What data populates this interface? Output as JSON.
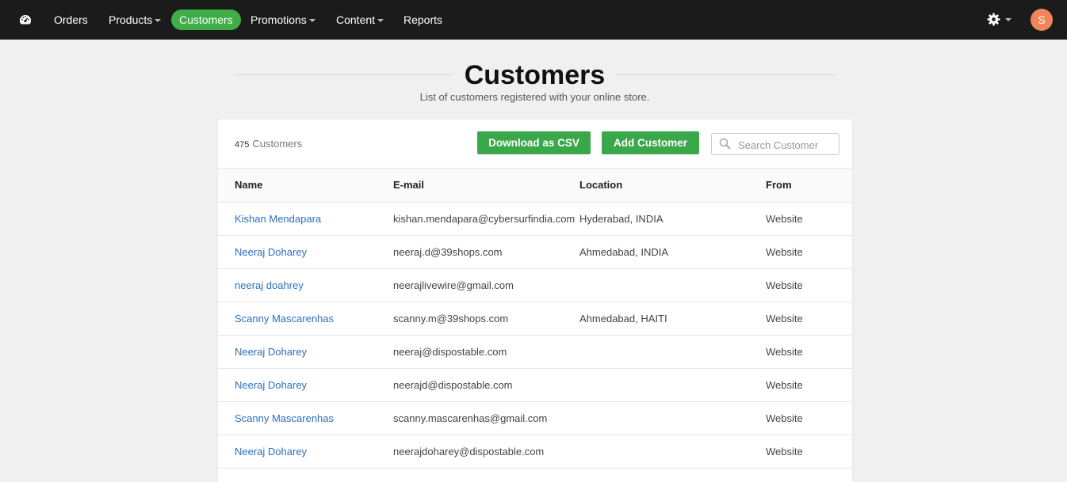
{
  "nav": {
    "dashboard_icon": "dashboard-icon",
    "items": [
      {
        "label": "Orders"
      },
      {
        "label": "Products"
      },
      {
        "label": "Customers"
      },
      {
        "label": "Promotions"
      },
      {
        "label": "Content"
      },
      {
        "label": "Reports"
      }
    ],
    "settings_icon": "gear-icon",
    "avatar_initial": "S",
    "accent_color": "#3fae49",
    "avatar_color": "#f0845a"
  },
  "page": {
    "title": "Customers",
    "subtitle": "List of customers registered with your online store."
  },
  "toolbar": {
    "count": "475",
    "count_label": "Customers",
    "download_label": "Download as CSV",
    "add_label": "Add Customer",
    "search_placeholder": "Search Customer"
  },
  "table": {
    "headers": [
      "Name",
      "E-mail",
      "Location",
      "From"
    ],
    "rows": [
      {
        "name": "Kishan Mendapara",
        "email": "kishan.mendapara@cybersurfindia.com",
        "location": "Hyderabad, INDIA",
        "from": "Website"
      },
      {
        "name": "Neeraj Doharey",
        "email": "neeraj.d@39shops.com",
        "location": "Ahmedabad, INDIA",
        "from": "Website"
      },
      {
        "name": "neeraj doahrey",
        "email": "neerajlivewire@gmail.com",
        "location": "",
        "from": "Website"
      },
      {
        "name": "Scanny Mascarenhas",
        "email": "scanny.m@39shops.com",
        "location": "Ahmedabad, HAITI",
        "from": "Website"
      },
      {
        "name": "Neeraj Doharey",
        "email": "neeraj@dispostable.com",
        "location": "",
        "from": "Website"
      },
      {
        "name": "Neeraj Doharey",
        "email": "neerajd@dispostable.com",
        "location": "",
        "from": "Website"
      },
      {
        "name": "Scanny Mascarenhas",
        "email": "scanny.mascarenhas@gmail.com",
        "location": "",
        "from": "Website"
      },
      {
        "name": "Neeraj Doharey",
        "email": "neerajdoharey@dispostable.com",
        "location": "",
        "from": "Website"
      }
    ]
  }
}
